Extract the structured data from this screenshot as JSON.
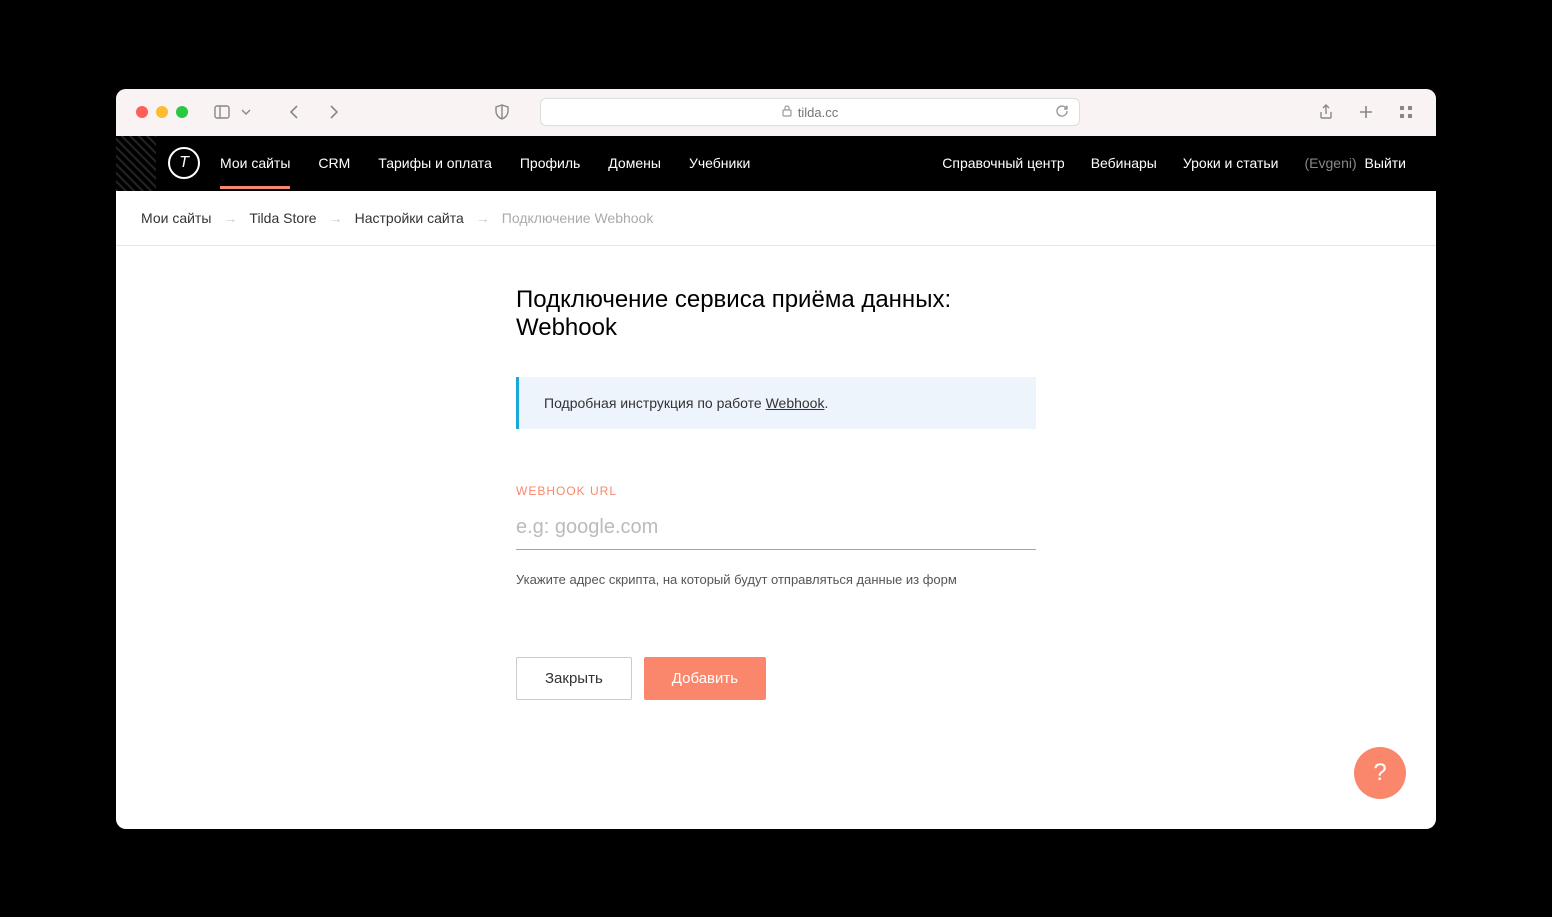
{
  "browser": {
    "url": "tilda.cc"
  },
  "header": {
    "nav_left": [
      "Мои сайты",
      "CRM",
      "Тарифы и оплата",
      "Профиль",
      "Домены",
      "Учебники"
    ],
    "active_index": 0,
    "nav_right": [
      "Справочный центр",
      "Вебинары",
      "Уроки и статьи"
    ],
    "user_name": "(Evgeni)",
    "logout_label": "Выйти"
  },
  "breadcrumb": {
    "items": [
      "Мои сайты",
      "Tilda Store",
      "Настройки сайта",
      "Подключение Webhook"
    ]
  },
  "page": {
    "title": "Подключение сервиса приёма данных: Webhook",
    "info_prefix": "Подробная инструкция по работе ",
    "info_link": "Webhook",
    "info_suffix": ".",
    "field_label": "WEBHOOK URL",
    "input_placeholder": "e.g: google.com",
    "input_value": "",
    "help_text": "Укажите адрес скрипта, на который будут отправляться данные из форм",
    "close_button": "Закрыть",
    "add_button": "Добавить"
  },
  "fab": {
    "label": "?"
  }
}
